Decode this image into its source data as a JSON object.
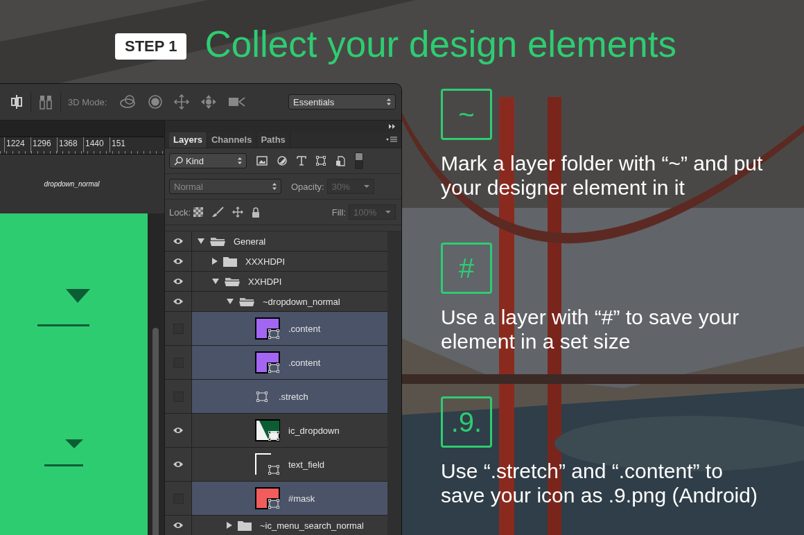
{
  "title": {
    "badge": "STEP 1",
    "heading": "Collect your design elements"
  },
  "toolbar": {
    "mode_label": "3D Mode:",
    "workspace": "Essentials"
  },
  "ruler": [
    "1224",
    "1296",
    "1368",
    "1440",
    "151"
  ],
  "canvas": {
    "artboard_label": "dropdown_normal"
  },
  "layers_panel": {
    "tabs": [
      {
        "label": "Layers",
        "selected": true
      },
      {
        "label": "Channels",
        "selected": false
      },
      {
        "label": "Paths",
        "selected": false
      }
    ],
    "filter": "Kind",
    "blend_mode": "Normal",
    "opacity_label": "Opacity:",
    "opacity": "30%",
    "lock_label": "Lock:",
    "fill_label": "Fill:",
    "fill": "100%",
    "layers": [
      {
        "name": "General",
        "kind": "folder",
        "visible": true,
        "selected": false,
        "expanded": true,
        "children": [
          {
            "name": "XXXHDPI",
            "kind": "folder",
            "visible": true,
            "selected": false,
            "expanded": false
          },
          {
            "name": "XXHDPI",
            "kind": "folder",
            "visible": true,
            "selected": false,
            "expanded": true,
            "children": [
              {
                "name": "~dropdown_normal",
                "kind": "folder",
                "visible": true,
                "selected": false,
                "expanded": true,
                "children": [
                  {
                    "name": ".content",
                    "kind": "corner",
                    "color": "#a366f2",
                    "visible": false,
                    "selected": true
                  },
                  {
                    "name": ".content",
                    "kind": "corner",
                    "color": "#a366f2",
                    "visible": false,
                    "selected": true
                  },
                  {
                    "name": ".stretch",
                    "kind": "shape",
                    "visible": false,
                    "selected": true
                  },
                  {
                    "name": "ic_dropdown",
                    "kind": "triangle",
                    "color": "#0b5e34",
                    "visible": true,
                    "selected": false
                  },
                  {
                    "name": "text_field",
                    "kind": "frame",
                    "visible": true,
                    "selected": false
                  },
                  {
                    "name": "#mask",
                    "kind": "corner",
                    "color": "#f25c5c",
                    "visible": false,
                    "selected": true
                  }
                ]
              },
              {
                "name": "~ic_menu_search_normal",
                "kind": "folder",
                "visible": true,
                "selected": false,
                "expanded": false
              }
            ]
          }
        ]
      }
    ]
  },
  "steps": [
    {
      "symbol": "~",
      "text": "Mark a layer folder with “~” and put your designer element in it"
    },
    {
      "symbol": "#",
      "text": "Use a layer with “#” to save your element in a set size"
    },
    {
      "symbol": ".9.",
      "text": "Use “.stretch” and “.content” to save your icon as .9.png (Android)"
    }
  ]
}
